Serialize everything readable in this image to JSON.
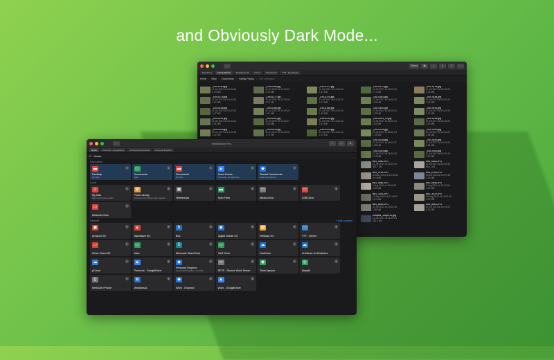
{
  "headline": "and Obviously Dark Mode...",
  "back_window": {
    "toolbar": [
      "Select",
      "",
      "",
      "",
      ""
    ],
    "tabs": [
      "NAS Drive",
      "Family Photos",
      "Backblaze B2",
      "iCloud",
      "Windows10",
      "FTP - My Website"
    ],
    "breadcrumb": [
      "Home",
      "iMac",
      "Documents",
      "Family Photos",
      "File Collection"
    ],
    "files": [
      {
        "name": "_DSC0163.jpg",
        "date": "11 Jul 2017 at 14:20:34",
        "size": "2.75 MB",
        "color": "#6f7d54"
      },
      {
        "name": "_DSC0169.jpg",
        "date": "11 Jul 2017 at 14:20:24",
        "size": "2.44 MB",
        "color": "#5e6b4c"
      },
      {
        "name": "_DSC0171.jpg",
        "date": "11 Jul 2017 at 14:20:34",
        "size": "2.34 MB",
        "color": "#7a8a5a"
      },
      {
        "name": "_DSC0172.jpg",
        "date": "11 Jul 2017 at 14:20:34",
        "size": "2.71 MB",
        "color": "#4e6a3c"
      },
      {
        "name": "_DSC0175.jpg",
        "date": "11 Jul 2017 at 14:20:24",
        "size": "1.36 MB",
        "color": "#8a7d5c"
      },
      {
        "name": "_DSC0176.jpg",
        "date": "11 Jul 2017 at 14:20:24",
        "size": "1.87 MB",
        "color": "#66704e"
      },
      {
        "name": "_DSC0177.jpg",
        "date": "11 Jul 2017 at 14:20:34",
        "size": "2.02 MB",
        "color": "#7b7a60"
      },
      {
        "name": "_DSC0178.jpg",
        "date": "11 Jul 2017 at 14:20:24",
        "size": "1.97 MB",
        "color": "#5b7247"
      },
      {
        "name": "_DSC0182.jpg",
        "date": "11 Jul 2017 at 14:20:24",
        "size": "1.53 MB",
        "color": "#6d7f55"
      },
      {
        "name": "_DSC0184.jpg",
        "date": "11 Jul 2017 at 14:20:24",
        "size": "1.48 MB",
        "color": "#7f8a62"
      },
      {
        "name": "_DSC0185.jpg",
        "date": "11 Jul 2017 at 14:20:24",
        "size": "1.47 MB",
        "color": "#56663f"
      },
      {
        "name": "_DSC0186.jpg",
        "date": "11 Jul 2017 at 14:20:24",
        "size": "1.41 MB",
        "color": "#74805a"
      },
      {
        "name": "_DSC0188.jpg",
        "date": "11 Jul 2017 at 14:20:24",
        "size": "1.45 MB",
        "color": "#6a7a50"
      },
      {
        "name": "_DSC0190.jpg",
        "date": "11 Jul 2017 at 14:20:24",
        "size": "1.78 MB",
        "color": "#5f6e46"
      },
      {
        "name": "_DSC0191.jpg",
        "date": "11 Jul 2017 at 14:20:24",
        "size": "1.42 MB",
        "color": "#7c8b63"
      },
      {
        "name": "_DSC0201.jpg",
        "date": "11 Jul 2017 at 14:20:24",
        "size": "1.31 MB",
        "color": "#687454"
      },
      {
        "name": "_DSC0202.jpg",
        "date": "11 Jul 2017 at 14:20:27",
        "size": "1.48 MB",
        "color": "#57693f"
      },
      {
        "name": "_DSC0213.jpg",
        "date": "11 Jul 2017 at 14:20:24",
        "size": "1.63 MB",
        "color": "#7a7f58"
      },
      {
        "name": "_DSC0214_01.jpg",
        "date": "11 Jul 2017 at 14:20:24",
        "size": "1.63 MB",
        "color": "#6b7d4f"
      },
      {
        "name": "_DSC0214.jpg",
        "date": "11 Jul 2017 at 14:20:24",
        "size": "1.53 MB",
        "color": "#5c6a48"
      },
      {
        "name": "_DSC0216.jpg",
        "date": "11 Jul 2017 at 14:20:24",
        "size": "1.42 MB",
        "color": "#758456"
      },
      {
        "name": "_DSC0218.jpg",
        "date": "11 Jul 2017 at 14:20:34",
        "size": "1.70 MB",
        "color": "#66774b"
      },
      {
        "name": "_DSC0220.jpg",
        "date": "11 Jul 2017 at 14:20:24",
        "size": "1.53 MB",
        "color": "#4f6238"
      },
      {
        "name": "_DSC0224.jpg",
        "date": "11 Jul 2017 at 14:20:24",
        "size": "1.78 MB",
        "color": "#7d8760"
      },
      {
        "name": "_DSC0225.jpg",
        "date": "11 Jul 2017 at 14:20:24",
        "size": "1.56 MB",
        "color": "#6c7650"
      },
      {
        "name": "",
        "date": "",
        "size": "",
        "color": ""
      },
      {
        "name": "",
        "date": "",
        "size": "",
        "color": ""
      },
      {
        "name": "",
        "date": "",
        "size": "",
        "color": ""
      },
      {
        "name": "_DSC0226.jpg",
        "date": "11 Jul 2017 at 14:20:27",
        "size": "1.68 MB",
        "color": "#5a6d44"
      },
      {
        "name": "_DSC0242.jpg",
        "date": "11 Jul 2017 at 14:20:24",
        "size": "1.86 MB",
        "color": "#7b8a5c"
      },
      {
        "name": "",
        "date": "",
        "size": "",
        "color": ""
      },
      {
        "name": "",
        "date": "",
        "size": "",
        "color": ""
      },
      {
        "name": "",
        "date": "",
        "size": "",
        "color": ""
      },
      {
        "name": "_DSC0243.jpg",
        "date": "11 Jul 2017 at 14:20:34",
        "size": "1.93 MB",
        "color": "#69784d"
      },
      {
        "name": "_DSC0343.jpg",
        "date": "11 Jul 2017 at 14:20:24",
        "size": "1.58 MB",
        "color": "#586a42"
      },
      {
        "name": "",
        "date": "",
        "size": "",
        "color": ""
      },
      {
        "name": "",
        "date": "",
        "size": "",
        "color": ""
      },
      {
        "name": "",
        "date": "",
        "size": "",
        "color": ""
      },
      {
        "name": "IMG_0482.JPG",
        "date": "11 Jul 2017 at 14:20:34",
        "size": "452.7 kB",
        "color": "#8a8f86"
      },
      {
        "name": "IMG_0483.JPG",
        "date": "11 Jul 2017 at 14:20:34",
        "size": "453.1 kB",
        "color": "#a8a59c"
      },
      {
        "name": "",
        "date": "",
        "size": "",
        "color": ""
      },
      {
        "name": "",
        "date": "",
        "size": "",
        "color": ""
      },
      {
        "name": "",
        "date": "",
        "size": "",
        "color": ""
      },
      {
        "name": "IMG_0763.JPG",
        "date": "28 May 2014 at 19:45:52",
        "size": "2.01 MB",
        "color": "#9c9583"
      },
      {
        "name": "IMG_0764.JPG",
        "date": "23 Jul 2016 at 10:57:28",
        "size": "2.29 MB",
        "color": "#7b8794"
      },
      {
        "name": "",
        "date": "",
        "size": "",
        "color": ""
      },
      {
        "name": "",
        "date": "",
        "size": "",
        "color": ""
      },
      {
        "name": "",
        "date": "",
        "size": "",
        "color": ""
      },
      {
        "name": "IMG_0946.JPG",
        "date": "6 Aug 2011 at 13:41:53",
        "size": "3.39 MB",
        "color": "#b0aca0"
      },
      {
        "name": "IMG_0948.JPG",
        "date": "6 Aug 2011 at 13:42:26",
        "size": "3.15 MB",
        "color": "#8c8a7d"
      },
      {
        "name": "",
        "date": "",
        "size": "",
        "color": ""
      },
      {
        "name": "",
        "date": "",
        "size": "",
        "color": ""
      },
      {
        "name": "",
        "date": "",
        "size": "",
        "color": ""
      },
      {
        "name": "IMG_3376.JPG",
        "date": "17 Aug 2012 at 17:48:37",
        "size": "1.67 MB",
        "color": "#6e6b5f"
      },
      {
        "name": "IMG_3376.JPG",
        "date": "19 Aug 2012 at 12:51:19",
        "size": "1.92 MB",
        "color": "#9a9789"
      },
      {
        "name": "",
        "date": "",
        "size": "",
        "color": ""
      },
      {
        "name": "",
        "date": "",
        "size": "",
        "color": ""
      },
      {
        "name": "",
        "date": "",
        "size": "",
        "color": ""
      },
      {
        "name": "IMG_8515.JPG",
        "date": "31 Jul 2013 at 20:22:38",
        "size": "1.98 MB",
        "color": "#7d7e73"
      },
      {
        "name": "IMG_8516.JPG",
        "date": "31 Jul 2013 at 20:22:57",
        "size": "2.20 MB",
        "color": "#a4a399"
      },
      {
        "name": "",
        "date": "",
        "size": "",
        "color": ""
      },
      {
        "name": "",
        "date": "",
        "size": "",
        "color": ""
      },
      {
        "name": "",
        "date": "",
        "size": "",
        "color": ""
      },
      {
        "name": "Octopus_192px-10.jpg",
        "date": "11 Jul 2017 at 14:20:24",
        "size": "182.1 KB",
        "color": "#3a4a5c"
      }
    ]
  },
  "front_window": {
    "title": "FileBrowser Pro",
    "tabs": [
      "Home",
      "Personal - GoogleDrive",
      "Company Documents",
      "Personal Dropbox"
    ],
    "breadcrumb": [
      "Home"
    ],
    "add_location": "+ Add Location",
    "sections": [
      {
        "label": "Favourites",
        "tiles": [
          {
            "name": "Desktop",
            "sub": "My Mac",
            "icon": "folder-icon",
            "color": "#e0433b",
            "glyph": "▬",
            "hl": true
          },
          {
            "name": "Documents",
            "sub": "iMac",
            "icon": "monitor-icon",
            "color": "#2f9e5f",
            "glyph": "▭",
            "hl": true
          },
          {
            "name": "Documents",
            "sub": "My Mac",
            "icon": "folder-icon",
            "color": "#e0433b",
            "glyph": "▬",
            "hl": true
          },
          {
            "name": "Team Drives",
            "sub": "Personal - GoogleDrive",
            "icon": "google-drive-icon",
            "color": "#3b82f6",
            "glyph": "▲",
            "hl": true
          },
          {
            "name": "Shared Documents",
            "sub": "Personal Dropbox",
            "icon": "dropbox-icon",
            "color": "#1a73e8",
            "glyph": "◆",
            "hl": true
          }
        ]
      },
      {
        "label": "Local",
        "tiles": [
          {
            "name": "My Mac",
            "sub": "Mac user's home folder",
            "icon": "home-icon",
            "color": "#e0433b",
            "glyph": "⌂",
            "hl": false
          },
          {
            "name": "Photo Library",
            "sub": "Access to the Photos app content",
            "icon": "photos-icon",
            "color": "#e89b2d",
            "glyph": "✿",
            "hl": false
          },
          {
            "name": "Slideshows",
            "sub": "",
            "icon": "slideshow-icon",
            "color": "#555555",
            "glyph": "▦",
            "hl": false
          },
          {
            "name": "Sync Files",
            "sub": "",
            "icon": "sync-folder-icon",
            "color": "#2f9e5f",
            "glyph": "▬",
            "hl": false
          },
          {
            "name": "Media Drive",
            "sub": "",
            "icon": "drive-icon",
            "color": "#777777",
            "glyph": "▭",
            "hl": false
          },
          {
            "name": "USB Drive",
            "sub": "",
            "icon": "usb-drive-icon",
            "color": "#e0433b",
            "glyph": "▭",
            "hl": false
          },
          {
            "name": "Network Drive",
            "sub": "",
            "icon": "network-drive-icon",
            "color": "#e0433b",
            "glyph": "▭",
            "hl": false
          }
        ]
      },
      {
        "label": "Remote",
        "tiles": [
          {
            "name": "Amazon S3",
            "sub": "",
            "icon": "amazon-s3-icon",
            "color": "#d9412b",
            "glyph": "▣",
            "hl": false
          },
          {
            "name": "Backblaze B2",
            "sub": "",
            "icon": "backblaze-icon",
            "color": "#d9412b",
            "glyph": "▲",
            "hl": false
          },
          {
            "name": "Box",
            "sub": "",
            "icon": "box-icon",
            "color": "#1e74c8",
            "glyph": "b",
            "hl": false
          },
          {
            "name": "Digital Ocean S3",
            "sub": "",
            "icon": "digital-ocean-icon",
            "color": "#1e74c8",
            "glyph": "◉",
            "hl": false
          },
          {
            "name": "Filebase S3",
            "sub": "",
            "icon": "filebase-icon",
            "color": "#e8a82a",
            "glyph": "▤",
            "hl": false
          },
          {
            "name": "FTP - Server",
            "sub": "",
            "icon": "ftp-icon",
            "color": "#2f80d0",
            "glyph": "▭",
            "hl": false
          },
          {
            "name": "iDrive Cloud S3",
            "sub": "",
            "icon": "idrive-icon",
            "color": "#d9412b",
            "glyph": "▭",
            "hl": false
          },
          {
            "name": "iMac",
            "sub": "",
            "icon": "monitor-icon",
            "color": "#2f9e5f",
            "glyph": "▭",
            "hl": false
          },
          {
            "name": "Microsoft SharePoint",
            "sub": "",
            "icon": "sharepoint-icon",
            "color": "#0f8b8d",
            "glyph": "S",
            "hl": false
          },
          {
            "name": "NAS Drive",
            "sub": "",
            "icon": "nas-icon",
            "color": "#2f9e5f",
            "glyph": "▭",
            "hl": false
          },
          {
            "name": "OneDrive",
            "sub": "",
            "icon": "onedrive-icon",
            "color": "#1e74c8",
            "glyph": "☁",
            "hl": false
          },
          {
            "name": "OneDrive for Business",
            "sub": "",
            "icon": "onedrive-icon",
            "color": "#1e74c8",
            "glyph": "☁",
            "hl": false
          },
          {
            "name": "pCloud",
            "sub": "",
            "icon": "pcloud-icon",
            "color": "#2f80d0",
            "glyph": "☁",
            "hl": false
          },
          {
            "name": "Personal - GoogleDrive",
            "sub": "",
            "icon": "google-drive-icon",
            "color": "#3b82f6",
            "glyph": "▲",
            "hl": false
          },
          {
            "name": "Personal Dropbox",
            "sub": "used: 40.09 GB free: 1.18 GB",
            "icon": "dropbox-icon",
            "color": "#1a73e8",
            "glyph": "◆",
            "hl": false
          },
          {
            "name": "SFTP - Secure Work Server",
            "sub": "",
            "icon": "sftp-icon",
            "color": "#777777",
            "glyph": "▭",
            "hl": false
          },
          {
            "name": "TimeCapsule",
            "sub": "",
            "icon": "timecapsule-icon",
            "color": "#2f9e5f",
            "glyph": "◉",
            "hl": false
          },
          {
            "name": "Wasabi",
            "sub": "",
            "icon": "wasabi-icon",
            "color": "#2f9e5f",
            "glyph": "◎",
            "hl": false
          },
          {
            "name": "WebDAV iPhone",
            "sub": "",
            "icon": "webdav-icon",
            "color": "#777777",
            "glyph": "▯",
            "hl": false
          },
          {
            "name": "Windows11",
            "sub": "",
            "icon": "windows-icon",
            "color": "#1e74c8",
            "glyph": "⊞",
            "hl": false
          },
          {
            "name": "Work - Dropbox",
            "sub": "",
            "icon": "dropbox-icon",
            "color": "#1a73e8",
            "glyph": "◆",
            "hl": false
          },
          {
            "name": "Work - GoogleDrive",
            "sub": "",
            "icon": "google-drive-icon",
            "color": "#3b82f6",
            "glyph": "▲",
            "hl": false
          }
        ]
      }
    ]
  }
}
